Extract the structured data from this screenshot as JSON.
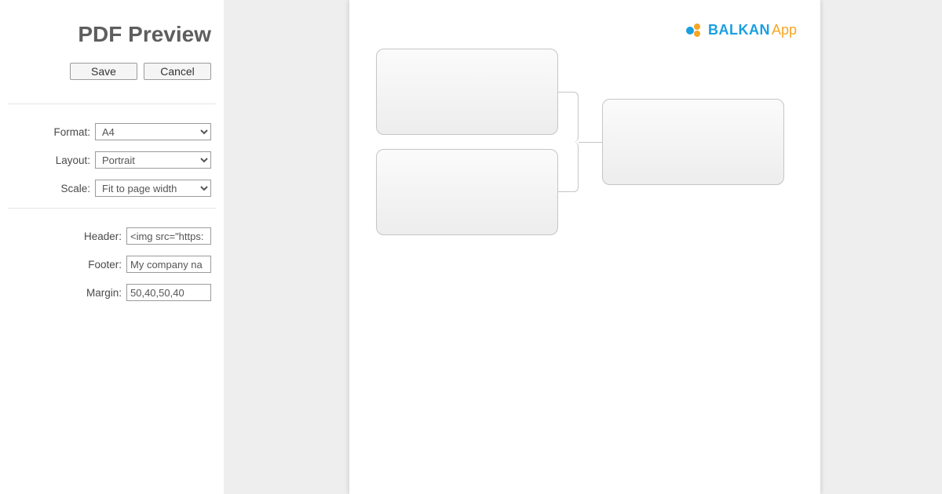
{
  "sidebar": {
    "title": "PDF Preview",
    "buttons": {
      "save": "Save",
      "cancel": "Cancel"
    },
    "fields": {
      "format": {
        "label": "Format:",
        "value": "A4"
      },
      "layout": {
        "label": "Layout:",
        "value": "Portrait"
      },
      "scale": {
        "label": "Scale:",
        "value": "Fit to page width"
      },
      "header": {
        "label": "Header:",
        "value": "<img src=\"https:"
      },
      "footer": {
        "label": "Footer:",
        "value": "My company na"
      },
      "margin": {
        "label": "Margin:",
        "value": "50,40,50,40"
      }
    }
  },
  "brand": {
    "name1": "BALKAN",
    "name2": "App"
  }
}
